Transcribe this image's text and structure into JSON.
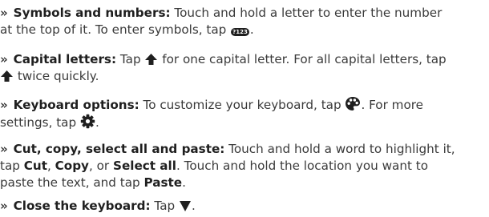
{
  "bullet": "»",
  "items": [
    {
      "heading": "Symbols and numbers:",
      "line1_text": " Touch and hold a letter to enter the number",
      "line2_text": "at the top of it. To enter symbols, tap ",
      "line2_end": ".",
      "symbols_key_label": "?123"
    },
    {
      "heading": "Capital letters:",
      "line1_a": " Tap ",
      "line1_b": " for one capital letter. For all capital letters, tap",
      "line2_b": " twice quickly."
    },
    {
      "heading": "Keyboard options:",
      "line1_a": " To customize your keyboard, tap ",
      "line1_b": ". For more",
      "line2_a": "settings, tap ",
      "line2_end": "."
    },
    {
      "heading": "Cut, copy, select all and paste:",
      "line1_text": " Touch and hold a word to highlight it,",
      "line2_a": "tap ",
      "cut": "Cut",
      "sep1": ", ",
      "copy": "Copy",
      "sep2": ", or ",
      "select_all": "Select all",
      "line2_b": ". Touch and hold the location you want to",
      "line3_a": "paste the text, and tap ",
      "paste": "Paste",
      "line3_end": "."
    },
    {
      "heading": "Close the keyboard:",
      "line1_a": " Tap ",
      "line1_end": "."
    }
  ]
}
